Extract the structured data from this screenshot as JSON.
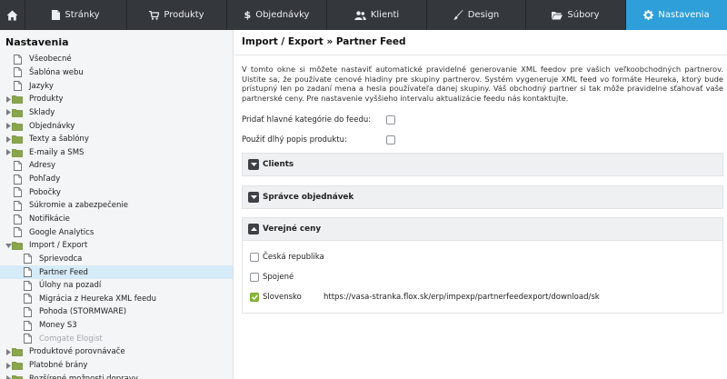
{
  "nav": {
    "items": [
      {
        "key": "pages",
        "label": "Stránky",
        "icon": "page-icon"
      },
      {
        "key": "products",
        "label": "Produkty",
        "icon": "cart-icon"
      },
      {
        "key": "orders",
        "label": "Objednávky",
        "icon": "dollar-icon"
      },
      {
        "key": "clients",
        "label": "Klienti",
        "icon": "users-icon"
      },
      {
        "key": "design",
        "label": "Design",
        "icon": "brush-icon"
      },
      {
        "key": "files",
        "label": "Súbory",
        "icon": "folder-open-icon"
      },
      {
        "key": "settings",
        "label": "Nastavenia",
        "icon": "gear-icon",
        "active": true
      }
    ]
  },
  "sidebar": {
    "title": "Nastavenia",
    "items": [
      {
        "label": "Všeobecné",
        "type": "page"
      },
      {
        "label": "Šablóna webu",
        "type": "page"
      },
      {
        "label": "Jazyky",
        "type": "page"
      },
      {
        "label": "Produkty",
        "type": "folder",
        "expanded": false
      },
      {
        "label": "Sklady",
        "type": "folder",
        "expanded": false
      },
      {
        "label": "Objednávky",
        "type": "folder",
        "expanded": false
      },
      {
        "label": "Texty a šablóny",
        "type": "folder",
        "expanded": false
      },
      {
        "label": "E-maily a SMS",
        "type": "folder",
        "expanded": false
      },
      {
        "label": "Adresy",
        "type": "page"
      },
      {
        "label": "Pohľady",
        "type": "page"
      },
      {
        "label": "Pobočky",
        "type": "page"
      },
      {
        "label": "Súkromie a zabezpečenie",
        "type": "page"
      },
      {
        "label": "Notifikácie",
        "type": "page"
      },
      {
        "label": "Google Analytics",
        "type": "page"
      },
      {
        "label": "Import / Export",
        "type": "folder",
        "expanded": true
      },
      {
        "label": "Sprievodca",
        "type": "page",
        "child": true
      },
      {
        "label": "Partner Feed",
        "type": "page",
        "child": true,
        "selected": true
      },
      {
        "label": "Úlohy na pozadí",
        "type": "page",
        "child": true
      },
      {
        "label": "Migrácia z Heureka XML feedu",
        "type": "page",
        "child": true
      },
      {
        "label": "Pohoda (STORMWARE)",
        "type": "page",
        "child": true
      },
      {
        "label": "Money S3",
        "type": "page",
        "child": true
      },
      {
        "label": "Comgate Elogist",
        "type": "page",
        "child": true,
        "disabled": true
      },
      {
        "label": "Produktové porovnávače",
        "type": "folder",
        "expanded": false
      },
      {
        "label": "Platobné brány",
        "type": "folder",
        "expanded": false
      },
      {
        "label": "Rozšírené možnosti dopravy",
        "type": "folder",
        "expanded": false
      }
    ]
  },
  "main": {
    "title": "Import / Export » Partner Feed",
    "intro": "V tomto okne si môžete nastaviť automatické pravidelné generovanie XML feedov pre vašich veľkoobchodných partnerov. Uistite sa, že používate cenové hladiny pre skupiny partnerov. Systém vygeneruje XML feed vo formáte Heureka, ktorý bude prístupný len po zadaní mena a hesla používateľa danej skupiny. Váš obchodný partner si tak môže pravidelne sťahovať vaše partnerské ceny. Pre nastavenie vyššieho intervalu aktualizácie feedu nás kontaktujte.",
    "options": {
      "main_categories_label": "Pridať hlavné kategórie do feedu:",
      "main_categories_checked": false,
      "long_description_label": "Použiť dlhý popis produktu:",
      "long_description_checked": false
    },
    "panels": [
      {
        "title": "Clients",
        "expanded": false
      },
      {
        "title": "Správce objednávek",
        "expanded": false
      },
      {
        "title": "Verejné ceny",
        "expanded": true
      }
    ],
    "countries": [
      {
        "label": "Česká republika",
        "checked": false,
        "url": ""
      },
      {
        "label": "Spojené",
        "checked": false,
        "url": ""
      },
      {
        "label": "Slovensko",
        "checked": true,
        "url": "https://vasa-stranka.flox.sk/erp/impexp/partnerfeedexport/download/sk"
      }
    ]
  },
  "colors": {
    "nav_bg": "#34373c",
    "nav_active": "#2e9fd8",
    "folder": "#8aa64a",
    "check_green": "#8bb83a",
    "selected_row": "#d6ebf8"
  }
}
